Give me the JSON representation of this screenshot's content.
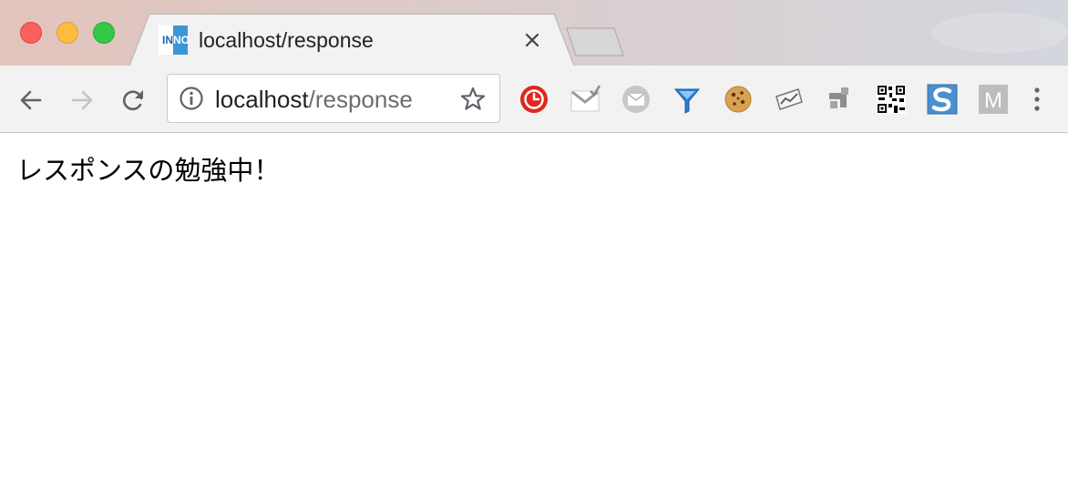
{
  "window": {
    "controls": [
      "close",
      "minimize",
      "maximize"
    ]
  },
  "tab": {
    "title": "localhost/response",
    "favicon_left": "IN",
    "favicon_right": "NO",
    "close_icon": "close-icon"
  },
  "toolbar": {
    "back_icon": "back-arrow-icon",
    "forward_icon": "forward-arrow-icon",
    "reload_icon": "reload-icon",
    "url_host": "localhost",
    "url_path": "/response",
    "info_icon": "info-icon",
    "bookmark_icon": "star-icon",
    "extensions": [
      {
        "name": "red-clock-extension-icon"
      },
      {
        "name": "gmail-checker-extension-icon"
      },
      {
        "name": "mail-extension-icon"
      },
      {
        "name": "funnel-extension-icon"
      },
      {
        "name": "cookie-extension-icon"
      },
      {
        "name": "chart-extension-icon"
      },
      {
        "name": "puzzle-extension-icon"
      },
      {
        "name": "qr-code-extension-icon"
      },
      {
        "name": "s-extension-icon",
        "text": "S"
      },
      {
        "name": "m-extension-icon",
        "text": "M"
      }
    ],
    "menu_icon": "more-vertical-icon"
  },
  "colors": {
    "close": "#fc605c",
    "minimize": "#fdbc40",
    "maximize": "#34c84a",
    "tab_bg": "#f2f2f2",
    "favicon_blue": "#3b97d8"
  },
  "page": {
    "text": "レスポンスの勉強中！"
  }
}
